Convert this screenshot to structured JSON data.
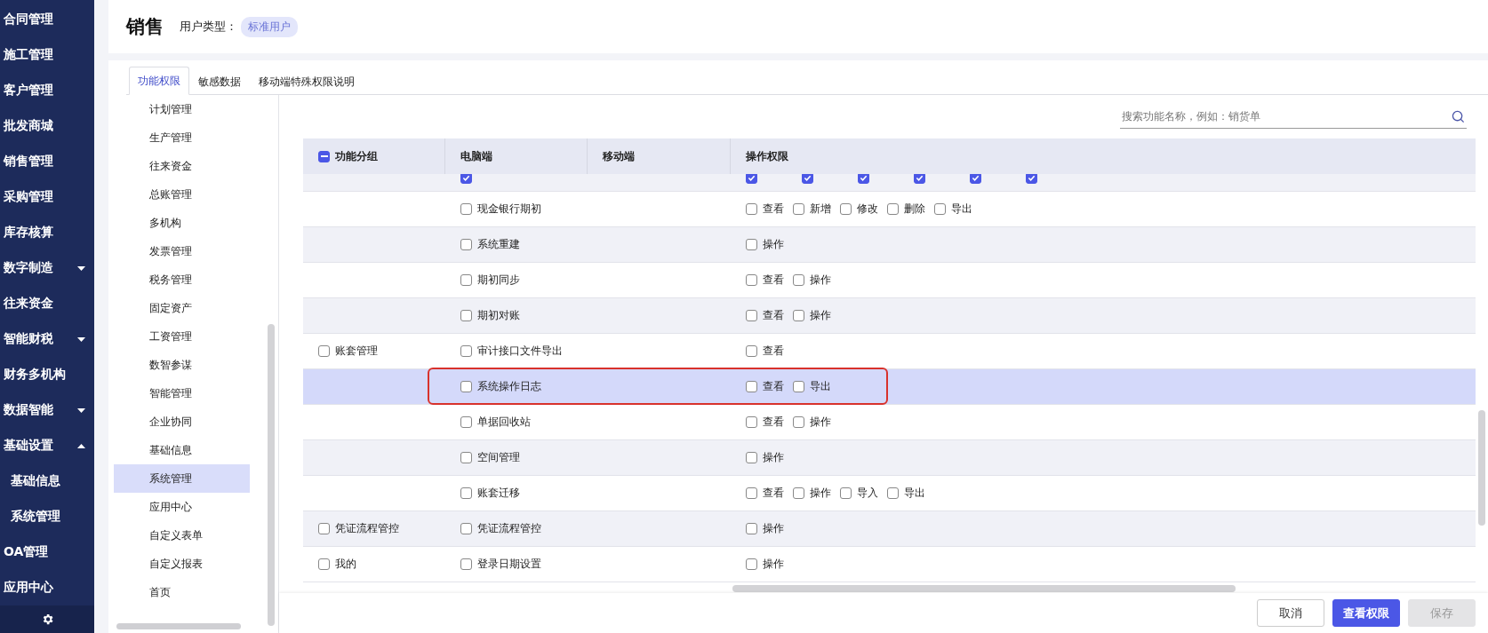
{
  "nav": {
    "items": [
      {
        "label": "合同管理"
      },
      {
        "label": "施工管理"
      },
      {
        "label": "客户管理"
      },
      {
        "label": "批发商城"
      },
      {
        "label": "销售管理"
      },
      {
        "label": "采购管理"
      },
      {
        "label": "库存核算"
      },
      {
        "label": "数字制造",
        "expanded": false
      },
      {
        "label": "往来资金"
      },
      {
        "label": "智能财税",
        "expanded": false
      },
      {
        "label": "财务多机构"
      },
      {
        "label": "数据智能",
        "expanded": false
      },
      {
        "label": "基础设置",
        "expanded": true,
        "children": [
          {
            "label": "基础信息"
          },
          {
            "label": "系统管理"
          }
        ]
      },
      {
        "label": "OA管理"
      },
      {
        "label": "应用中心"
      }
    ]
  },
  "header": {
    "title": "销售",
    "user_type_label": "用户类型：",
    "user_type": "标准用户"
  },
  "tabs": [
    {
      "label": "功能权限",
      "selected": true
    },
    {
      "label": "敏感数据",
      "selected": false
    },
    {
      "label": "移动端特殊权限说明",
      "selected": false
    }
  ],
  "tree": {
    "items": [
      {
        "label": "计划管理",
        "selected": false
      },
      {
        "label": "生产管理",
        "selected": false
      },
      {
        "label": "往来资金",
        "selected": false
      },
      {
        "label": "总账管理",
        "selected": false
      },
      {
        "label": "多机构",
        "selected": false
      },
      {
        "label": "发票管理",
        "selected": false
      },
      {
        "label": "税务管理",
        "selected": false
      },
      {
        "label": "固定资产",
        "selected": false
      },
      {
        "label": "工资管理",
        "selected": false
      },
      {
        "label": "数智参谋",
        "selected": false
      },
      {
        "label": "智能管理",
        "selected": false
      },
      {
        "label": "企业协同",
        "selected": false
      },
      {
        "label": "基础信息",
        "selected": false
      },
      {
        "label": "系统管理",
        "selected": true
      },
      {
        "label": "应用中心",
        "selected": false
      },
      {
        "label": "自定义表单",
        "selected": false
      },
      {
        "label": "自定义报表",
        "selected": false
      },
      {
        "label": "首页",
        "selected": false
      }
    ]
  },
  "search": {
    "placeholder": "搜索功能名称，例如：销货单"
  },
  "table": {
    "columns": [
      {
        "label": "功能分组",
        "indeterminate": true
      },
      {
        "label": "电脑端"
      },
      {
        "label": "移动端"
      },
      {
        "label": "操作权限"
      }
    ],
    "rows": [
      {
        "kind": "clipped",
        "feature": {
          "checked": true
        },
        "permissions": [
          {
            "checked": true
          },
          {
            "checked": true
          },
          {
            "checked": true
          },
          {
            "checked": true
          },
          {
            "checked": true
          },
          {
            "checked": true
          }
        ],
        "selected": false,
        "annotated": false
      },
      {
        "feature": {
          "label": "现金银行期初",
          "checked": false
        },
        "permissions": [
          {
            "label": "查看",
            "checked": false
          },
          {
            "label": "新增",
            "checked": false
          },
          {
            "label": "修改",
            "checked": false
          },
          {
            "label": "删除",
            "checked": false
          },
          {
            "label": "导出",
            "checked": false
          }
        ],
        "selected": false,
        "annotated": false
      },
      {
        "feature": {
          "label": "系统重建",
          "checked": false
        },
        "permissions": [
          {
            "label": "操作",
            "checked": false
          }
        ],
        "selected": false,
        "annotated": false
      },
      {
        "feature": {
          "label": "期初同步",
          "checked": false
        },
        "permissions": [
          {
            "label": "查看",
            "checked": false
          },
          {
            "label": "操作",
            "checked": false
          }
        ],
        "selected": false,
        "annotated": false
      },
      {
        "feature": {
          "label": "期初对账",
          "checked": false
        },
        "permissions": [
          {
            "label": "查看",
            "checked": false
          },
          {
            "label": "操作",
            "checked": false
          }
        ],
        "selected": false,
        "annotated": false
      },
      {
        "group": {
          "label": "账套管理",
          "checked": false
        },
        "feature": {
          "label": "审计接口文件导出",
          "checked": false
        },
        "permissions": [
          {
            "label": "查看",
            "checked": false
          }
        ],
        "selected": false,
        "annotated": false
      },
      {
        "feature": {
          "label": "系统操作日志",
          "checked": false
        },
        "permissions": [
          {
            "label": "查看",
            "checked": false
          },
          {
            "label": "导出",
            "checked": false
          }
        ],
        "selected": true,
        "annotated": true
      },
      {
        "feature": {
          "label": "单据回收站",
          "checked": false
        },
        "permissions": [
          {
            "label": "查看",
            "checked": false
          },
          {
            "label": "操作",
            "checked": false
          }
        ],
        "selected": false,
        "annotated": false
      },
      {
        "feature": {
          "label": "空间管理",
          "checked": false
        },
        "permissions": [
          {
            "label": "操作",
            "checked": false
          }
        ],
        "selected": false,
        "annotated": false
      },
      {
        "feature": {
          "label": "账套迁移",
          "checked": false
        },
        "permissions": [
          {
            "label": "查看",
            "checked": false
          },
          {
            "label": "操作",
            "checked": false
          },
          {
            "label": "导入",
            "checked": false
          },
          {
            "label": "导出",
            "checked": false
          }
        ],
        "selected": false,
        "annotated": false
      },
      {
        "group": {
          "label": "凭证流程管控",
          "checked": false
        },
        "feature": {
          "label": "凭证流程管控",
          "checked": false
        },
        "permissions": [
          {
            "label": "操作",
            "checked": false
          }
        ],
        "selected": false,
        "annotated": false
      },
      {
        "group": {
          "label": "我的",
          "checked": false
        },
        "feature": {
          "label": "登录日期设置",
          "checked": false
        },
        "permissions": [
          {
            "label": "操作",
            "checked": false
          }
        ],
        "selected": false,
        "annotated": false
      }
    ]
  },
  "footer": {
    "buttons": [
      {
        "label": "取消",
        "kind": "secondary"
      },
      {
        "label": "查看权限",
        "kind": "primary"
      },
      {
        "label": "保存",
        "kind": "disabled"
      }
    ]
  }
}
